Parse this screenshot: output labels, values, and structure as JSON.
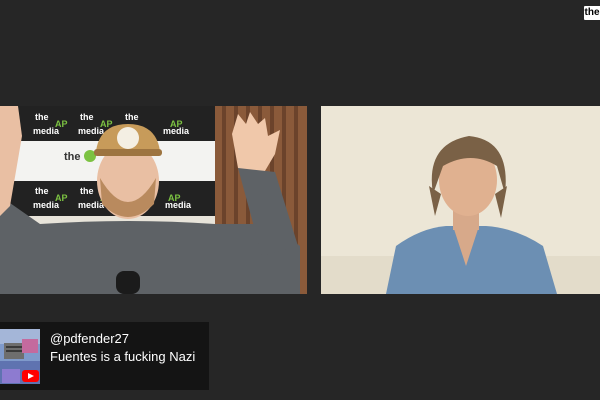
{
  "corner_logo": {
    "text": "the"
  },
  "feeds": {
    "left": {
      "background_brand": [
        "the",
        "AP",
        "media"
      ],
      "shirt_color": "#5e6266"
    },
    "right": {
      "wall_color": "#ece6d6",
      "shirt_color": "#6c8fb3"
    }
  },
  "comment": {
    "username": "@pdfender27",
    "text": "Fuentes is a fucking Nazi",
    "platform_icon": "youtube-icon"
  },
  "colors": {
    "background": "#262626",
    "comment_bg": "#141414",
    "youtube_red": "#ff0000"
  }
}
